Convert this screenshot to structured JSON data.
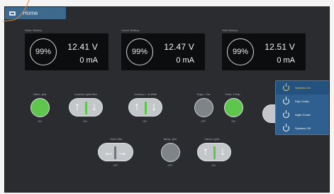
{
  "home": {
    "label": "Home"
  },
  "batteries": [
    {
      "label": "Radio Battery",
      "percent": "99%",
      "voltage": "12.41 V",
      "current": "0 mA"
    },
    {
      "label": "House Battery",
      "percent": "99%",
      "voltage": "12.47 V",
      "current": "0 mA"
    },
    {
      "label": "Start Battery",
      "percent": "99%",
      "voltage": "12.51 V",
      "current": "0 mA"
    }
  ],
  "controls": [
    {
      "label": "Cabin...ghts",
      "state": "ON"
    },
    {
      "label": "Courtesy Lights Blue",
      "state": "ON"
    },
    {
      "label": "Courtesy L...ts White",
      "state": "ON"
    },
    {
      "label": "Engin... Fan",
      "state": "OFF"
    },
    {
      "label": "Fresh...Pump",
      "state": "ON"
    },
    {
      "label": "Hand Lifter",
      "state": "OFF"
    },
    {
      "label": "Navig...ghts",
      "state": "OFF"
    },
    {
      "label": "Saloon Lights",
      "state": "ON"
    }
  ],
  "menu": [
    {
      "label": "Systems On"
    },
    {
      "label": "Day Cruise"
    },
    {
      "label": "Night Cruise"
    },
    {
      "label": "Systems Off"
    }
  ],
  "colors": {
    "on": "#5fc64d",
    "accent": "#3d6a8c",
    "menu": "#2f5f8e"
  }
}
